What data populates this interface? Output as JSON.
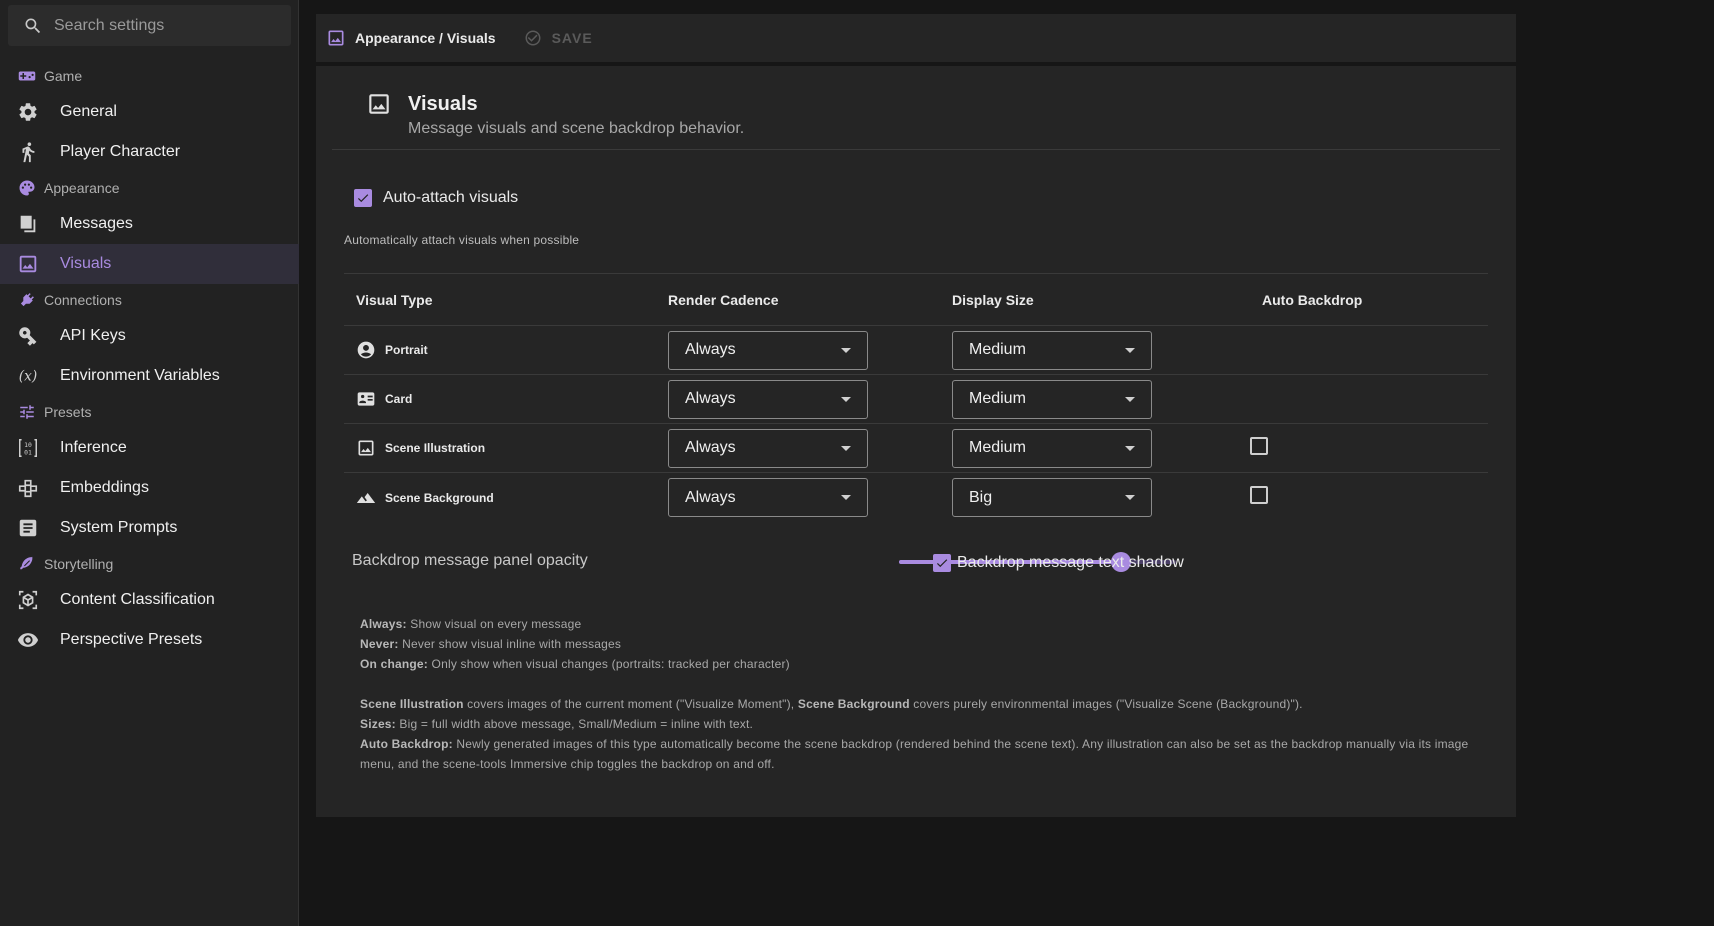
{
  "search": {
    "placeholder": "Search settings"
  },
  "sidebar": {
    "items": [
      {
        "type": "section",
        "label": "Game",
        "icon": "gamepad-icon"
      },
      {
        "type": "item",
        "label": "General",
        "icon": "gear-icon"
      },
      {
        "type": "item",
        "label": "Player Character",
        "icon": "person-icon"
      },
      {
        "type": "section",
        "label": "Appearance",
        "icon": "palette-icon"
      },
      {
        "type": "item",
        "label": "Messages",
        "icon": "messages-icon"
      },
      {
        "type": "item",
        "label": "Visuals",
        "icon": "image-icon",
        "active": true
      },
      {
        "type": "section",
        "label": "Connections",
        "icon": "plug-icon"
      },
      {
        "type": "item",
        "label": "API Keys",
        "icon": "key-icon"
      },
      {
        "type": "item",
        "label": "Environment Variables",
        "icon": "variable-icon"
      },
      {
        "type": "section",
        "label": "Presets",
        "icon": "tune-icon"
      },
      {
        "type": "item",
        "label": "Inference",
        "icon": "binary-icon"
      },
      {
        "type": "item",
        "label": "Embeddings",
        "icon": "hub-icon"
      },
      {
        "type": "item",
        "label": "System Prompts",
        "icon": "document-icon"
      },
      {
        "type": "section",
        "label": "Storytelling",
        "icon": "feather-icon"
      },
      {
        "type": "item",
        "label": "Content Classification",
        "icon": "cube-scan-icon"
      },
      {
        "type": "item",
        "label": "Perspective Presets",
        "icon": "eye-icon"
      }
    ]
  },
  "topbar": {
    "breadcrumb": "Appearance / Visuals",
    "save_label": "SAVE"
  },
  "panel": {
    "title": "Visuals",
    "subtitle": "Message visuals and scene backdrop behavior.",
    "auto_attach_label": "Auto-attach visuals",
    "auto_attach_checked": true,
    "auto_attach_hint": "Automatically attach visuals when possible"
  },
  "table": {
    "headers": [
      "Visual Type",
      "Render Cadence",
      "Display Size",
      "Auto Backdrop"
    ],
    "rows": [
      {
        "name": "Portrait",
        "icon": "account-circle-icon",
        "cadence": "Always",
        "size": "Medium",
        "backdrop": null
      },
      {
        "name": "Card",
        "icon": "id-card-icon",
        "cadence": "Always",
        "size": "Medium",
        "backdrop": null
      },
      {
        "name": "Scene Illustration",
        "icon": "image-icon",
        "cadence": "Always",
        "size": "Medium",
        "backdrop": false
      },
      {
        "name": "Scene Background",
        "icon": "landscape-icon",
        "cadence": "Always",
        "size": "Big",
        "backdrop": false
      }
    ]
  },
  "opacity": {
    "label": "Backdrop message panel opacity",
    "value": 0.8
  },
  "shadow": {
    "label": "Backdrop message text shadow",
    "checked": true
  },
  "legend": {
    "always_term": "Always:",
    "always_desc": " Show visual on every message",
    "never_term": "Never:",
    "never_desc": " Never show visual inline with messages",
    "onchange_term": "On change:",
    "onchange_desc": " Only show when visual changes (portraits: tracked per character)",
    "illus_term": "Scene Illustration",
    "illus_desc": " covers images of the current moment (\"Visualize Moment\"), ",
    "bg_term": "Scene Background",
    "bg_desc": " covers purely environmental images (\"Visualize Scene (Background)\").",
    "sizes_term": "Sizes:",
    "sizes_desc": " Big = full width above message, Small/Medium = inline with text.",
    "autob_term": "Auto Backdrop:",
    "autob_desc": " Newly generated images of this type automatically become the scene backdrop (rendered behind the scene text). Any illustration can also be set as the backdrop manually via its image menu, and the scene-tools Immersive chip toggles the backdrop on and off."
  },
  "colors": {
    "accent": "#a98be0",
    "background": "#161616",
    "panel": "#252525",
    "sidebar": "#222222"
  }
}
